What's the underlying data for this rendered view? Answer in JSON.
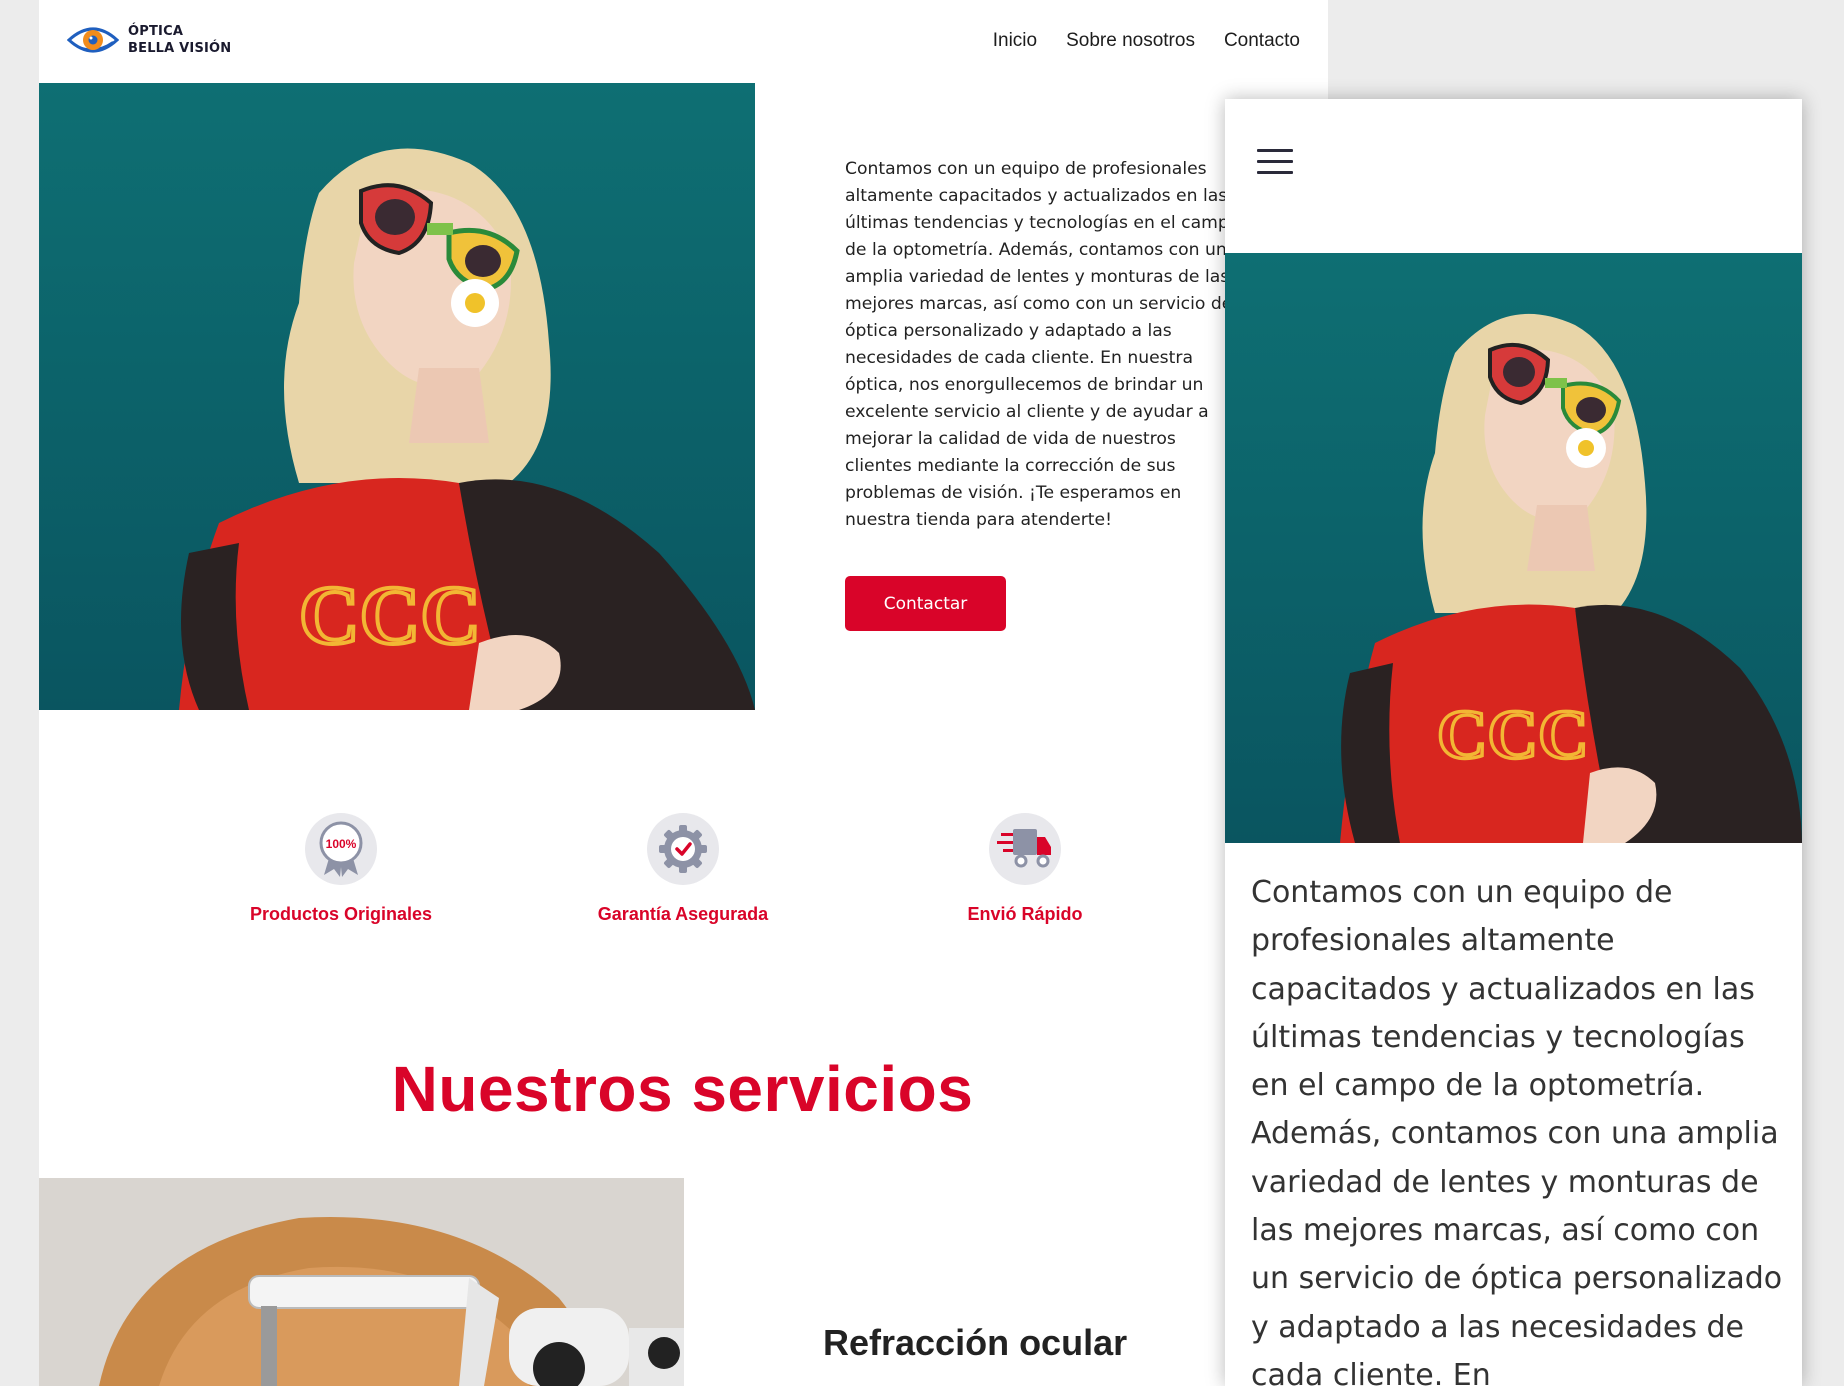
{
  "brand": {
    "line1": "ÓPTICA",
    "line2": "BELLA VISIÓN",
    "accent": "#d90429",
    "logo_orange": "#f28c1c",
    "logo_blue": "#1f5fbf"
  },
  "nav": {
    "items": [
      "Inicio",
      "Sobre nosotros",
      "Contacto"
    ]
  },
  "hero": {
    "paragraph": "Contamos con un equipo de profesionales altamente capacitados y actualizados en las últimas tendencias y tecnologías en el campo de la optometría. Además, contamos con una amplia variedad de lentes y monturas de las mejores marcas, así como con un servicio de óptica personalizado y adaptado a las necesidades de cada cliente. En nuestra óptica, nos enorgullecemos de brindar un excelente servicio al cliente y de ayudar a mejorar la calidad de vida de nuestros clientes mediante la corrección de sus problemas de visión. ¡Te esperamos en nuestra tienda para atenderte!",
    "button_label": "Contactar",
    "photo_icon": "woman-with-sunglasses-photo"
  },
  "features": [
    {
      "label": "Productos Originales",
      "icon": "badge-100-icon",
      "badge_text": "100%"
    },
    {
      "label": "Garantía Asegurada",
      "icon": "gear-check-icon"
    },
    {
      "label": "Envió Rápido",
      "icon": "delivery-truck-icon"
    }
  ],
  "services": {
    "title": "Nuestros servicios",
    "items": [
      {
        "title": "Refracción ocular",
        "photo_icon": "eye-exam-photo"
      }
    ]
  },
  "mobile": {
    "menu_icon": "hamburger-menu-icon",
    "paragraph": "Contamos con un equipo de profesionales altamente capacitados y actualizados en las últimas tendencias y tecnologías en el campo de la optometría. Además, contamos con una amplia variedad de lentes y monturas de las mejores marcas, así como con un servicio de óptica personalizado y adaptado a las necesidades de cada cliente. En"
  }
}
